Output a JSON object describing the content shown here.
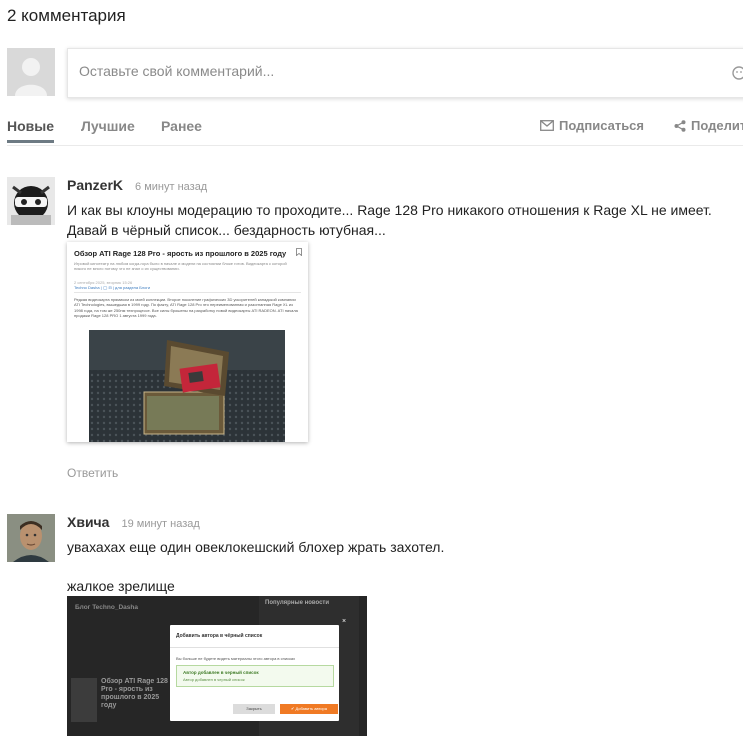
{
  "header": {
    "title": "2 комментария"
  },
  "composer": {
    "placeholder": "Оставьте свой комментарий..."
  },
  "tabs": {
    "items": [
      {
        "label": "Новые"
      },
      {
        "label": "Лучшие"
      },
      {
        "label": "Ранее"
      }
    ],
    "subscribe_label": "Подписаться",
    "share_label": "Поделит"
  },
  "comments": [
    {
      "author": "PanzerK",
      "time": "6 минут назад",
      "text_lines": [
        "И как вы клоуны модерацию то проходите... Rage 128 Pro никакого отношения к Rage XL не имеет.",
        "Давай в чёрный список... бездарность ютубная..."
      ],
      "reply_label": "Ответить",
      "attachment": {
        "title": "Обзор ATI Rage 128 Pro - ярость из прошлого в 2025 году",
        "subtitle": "Игровой кинотеатр на любом когда-гора было в начале и модели на состоянии блоке готов. Видеокарта с которой никого не много потому что не знал о их существовании.",
        "meta": "2 сентября 2025, вторник 15:26",
        "meta2": "Techno Dasha | ◯ ⊟ | для раздела Блоги",
        "paragraph": "Редкая видеокарта прямиком из моей коллекции. Второе поколение графических 3D ускорителей канадской компании ATI Technologies, вышедшая в 1999 году. По факту, ATI Rage 128 Pro это переименованная и разогнанная Rage XL из 1998 года, на том же 250нм техпроцессе. Все силы брошены на разработку новой видеокарты ATI RADEON. ATI начала продажи Rage 128 PRO 1 августа 1999 года."
      }
    },
    {
      "author": "Хвича",
      "time": "19 минут назад",
      "text_lines": [
        "увахахах еще один овеклокешский блохер жрать захотел.",
        "",
        "жалкое зрелище"
      ],
      "attachment": {
        "bg_title": "Блог Techno_Dasha",
        "bg_card": "Обзор ATI Rage 128 Pro - ярость из прошлого в 2025 году",
        "side_title": "Популярные новости",
        "modal_title": "Добавить автора в чёрный список",
        "modal_text": "Вы больше не будете видеть материалы этого автора в списках",
        "ok_title": "Автор добавлен в черный список",
        "ok_sub": "Автор добавлен в черный список",
        "close_label": "Закрыть",
        "add_label": "✔ Добавить автора",
        "close_x": "×"
      }
    }
  ],
  "colors": {
    "accent": "#f07a24",
    "tab_underline": "#6d7a83",
    "muted": "#888888"
  }
}
